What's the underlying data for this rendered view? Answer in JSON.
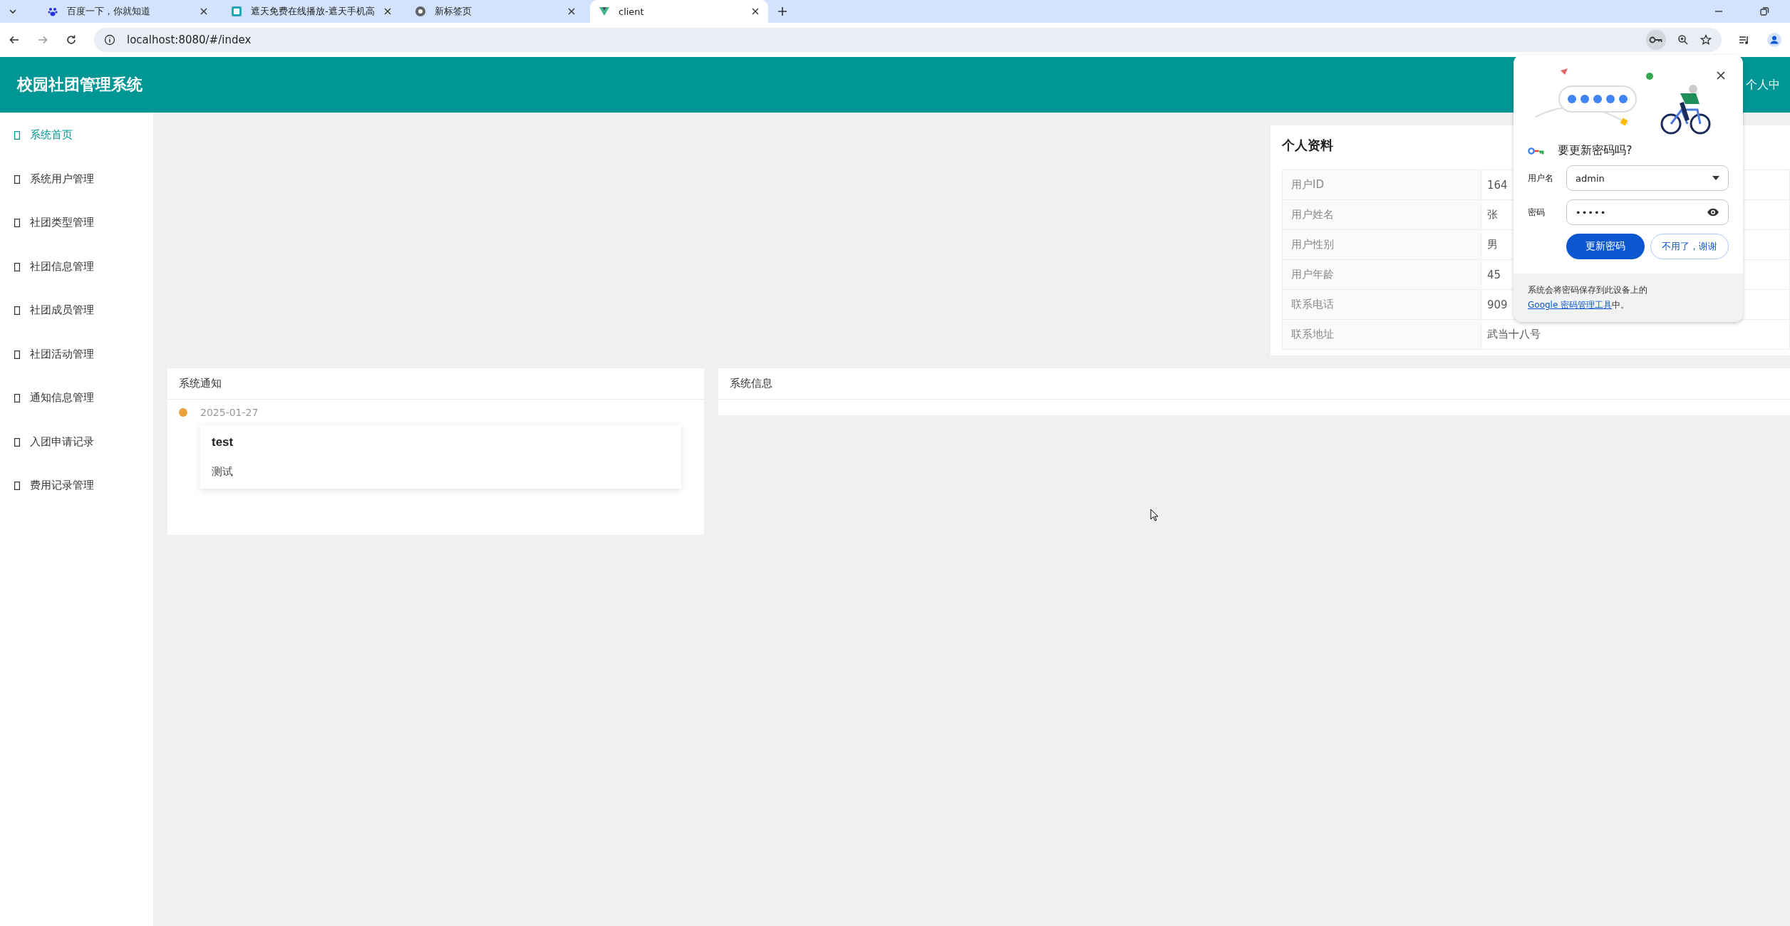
{
  "browser": {
    "tabs": [
      {
        "title": "百度一下，你就知道",
        "selected": false
      },
      {
        "title": "遮天免费在线播放-遮天手机高",
        "selected": false
      },
      {
        "title": "新标签页",
        "selected": false
      },
      {
        "title": "client",
        "selected": true
      }
    ],
    "url": "localhost:8080/#/index"
  },
  "header": {
    "title": "校园社团管理系统",
    "user_menu": "个人中"
  },
  "sidebar": {
    "items": [
      {
        "label": "系统首页",
        "selected": true
      },
      {
        "label": "系统用户管理",
        "selected": false
      },
      {
        "label": "社团类型管理",
        "selected": false
      },
      {
        "label": "社团信息管理",
        "selected": false
      },
      {
        "label": "社团成员管理",
        "selected": false
      },
      {
        "label": "社团活动管理",
        "selected": false
      },
      {
        "label": "通知信息管理",
        "selected": false
      },
      {
        "label": "入团申请记录",
        "selected": false
      },
      {
        "label": "费用记录管理",
        "selected": false
      }
    ]
  },
  "profile": {
    "title": "个人资料",
    "rows": [
      {
        "label": "用户ID",
        "value": "164"
      },
      {
        "label": "用户姓名",
        "value": "张"
      },
      {
        "label": "用户性别",
        "value": "男"
      },
      {
        "label": "用户年龄",
        "value": "45"
      },
      {
        "label": "联系电话",
        "value": "909"
      },
      {
        "label": "联系地址",
        "value": "武当十八号"
      }
    ]
  },
  "notices": {
    "title": "系统通知",
    "items": [
      {
        "date": "2025-01-27",
        "title": "test",
        "content": "测试"
      }
    ]
  },
  "system_info": {
    "title": "系统信息"
  },
  "password_prompt": {
    "title": "要更新密码吗?",
    "username_label": "用户名",
    "username": "admin",
    "password_label": "密码",
    "password": "•••••",
    "update_button": "更新密码",
    "decline_button": "不用了，谢谢",
    "footer_text": "系统会将密码保存到此设备上的 ",
    "footer_link": "Google 密码管理工具",
    "footer_end": "中。"
  }
}
